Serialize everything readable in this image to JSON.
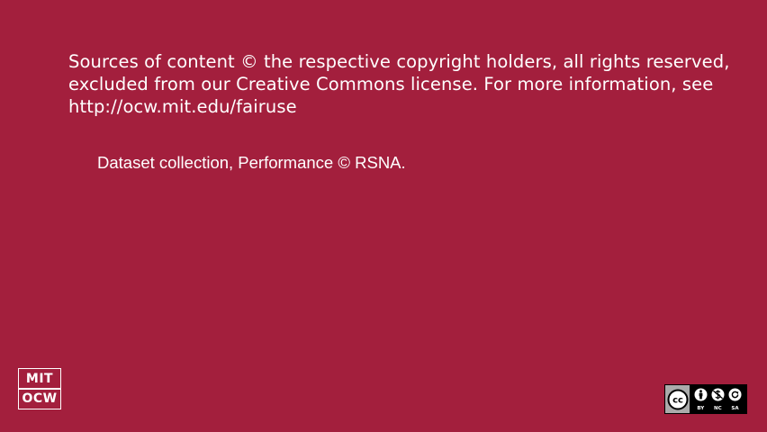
{
  "notice": {
    "text": "Sources of content © the respective copyright holders, all rights reserved, excluded from our Creative Commons license. For more information, see http://ocw.mit.edu/fairuse"
  },
  "attribution": {
    "text": "Dataset collection, Performance © RSNA."
  },
  "logo": {
    "line1": "MIT",
    "line2": "OCW"
  },
  "license_badge": {
    "badge_text": "cc",
    "labels": [
      "BY",
      "NC",
      "SA"
    ],
    "icons": [
      "person-icon",
      "no-dollar-icon",
      "share-alike-icon"
    ]
  },
  "colors": {
    "background": "#a31f3d",
    "text": "#ffffff"
  }
}
